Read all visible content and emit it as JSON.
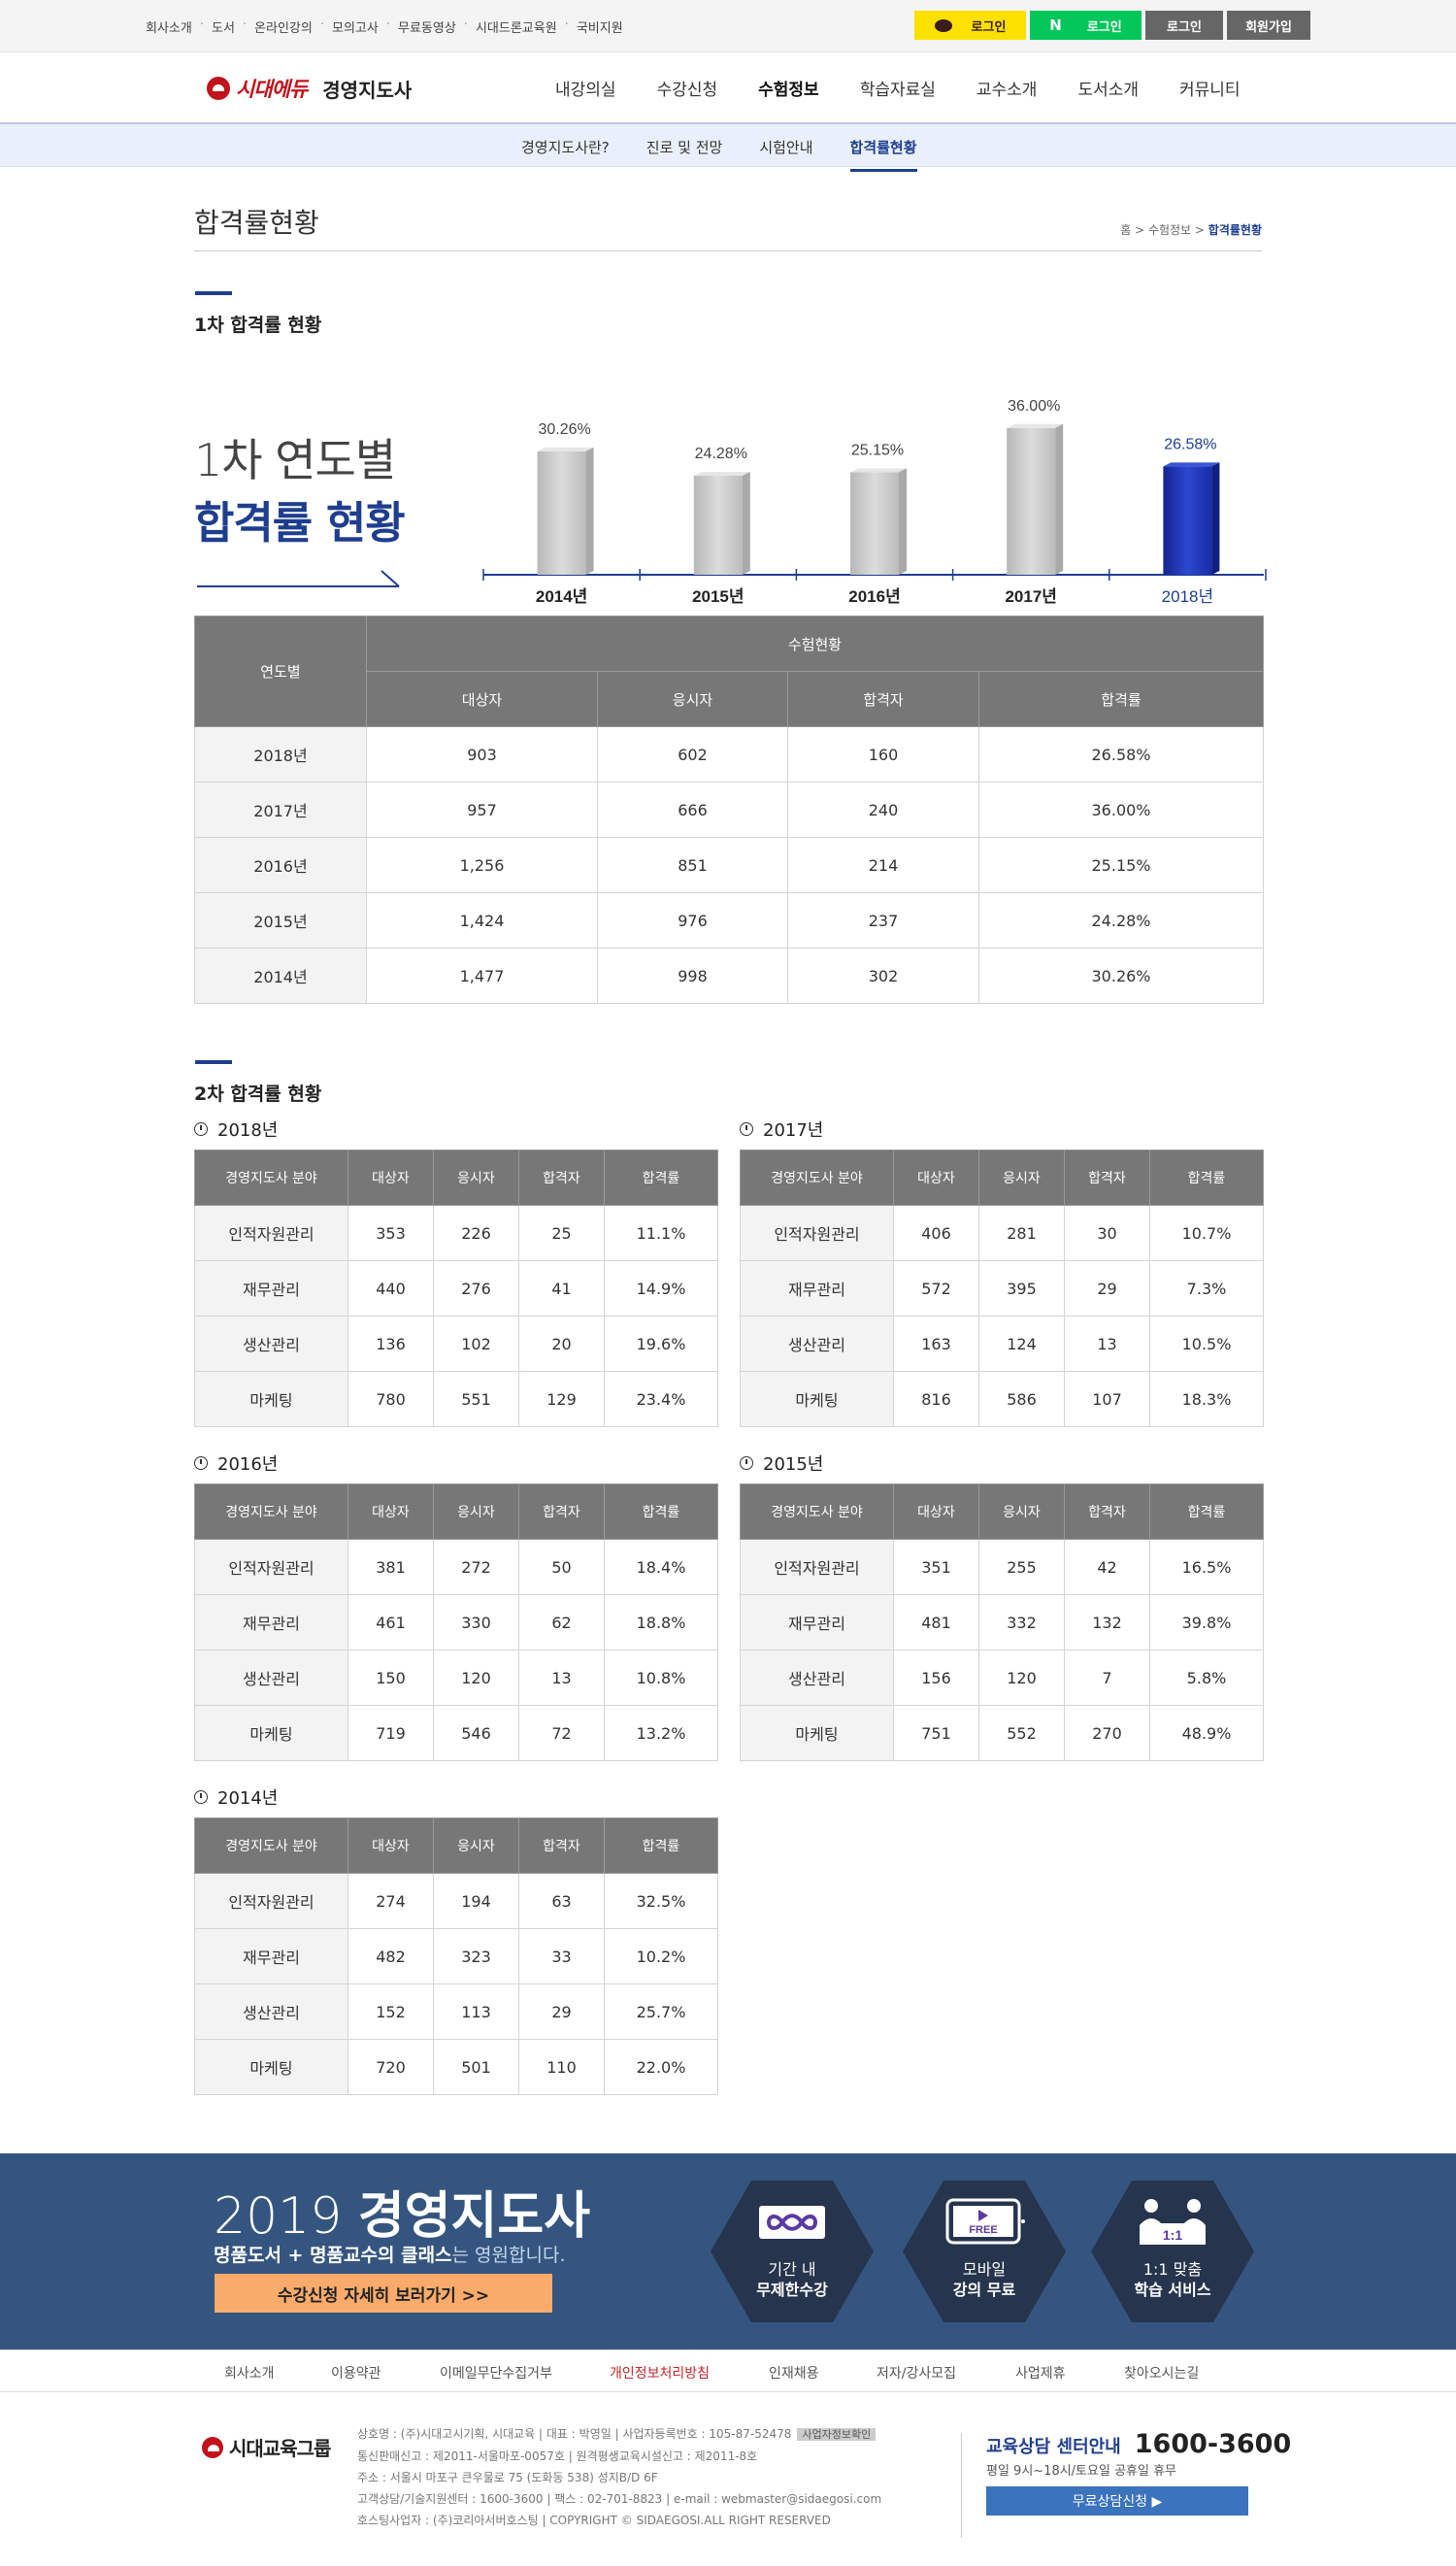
{
  "topbar": {
    "links": [
      "회사소개",
      "도서",
      "온라인강의",
      "모의고사",
      "무료동영상",
      "시대드론교육원",
      "국비지원"
    ],
    "kakao_login": "로그인",
    "naver_login": "로그인",
    "login": "로그인",
    "signup": "회원가입"
  },
  "header": {
    "logo": "시대에듀",
    "site": "경영지도사",
    "menu": [
      "내강의실",
      "수강신청",
      "수험정보",
      "학습자료실",
      "교수소개",
      "도서소개",
      "커뮤니티"
    ],
    "active_menu": "수험정보"
  },
  "subnav": {
    "items": [
      "경영지도사란?",
      "진로 및 전망",
      "시험안내",
      "합격률현황"
    ],
    "active": "합격률현황"
  },
  "page": {
    "title": "합격률현황",
    "breadcrumb": [
      "홈",
      "수험정보",
      "합격률현황"
    ]
  },
  "section1": {
    "title": "1차 합격률 현황",
    "big_line1": "1차 연도별",
    "big_line2": "합격률 현황"
  },
  "chart_data": {
    "type": "bar",
    "categories": [
      "2014년",
      "2015년",
      "2016년",
      "2017년",
      "2018년"
    ],
    "values": [
      30.26,
      24.28,
      25.15,
      36.0,
      26.58
    ],
    "labels": [
      "30.26%",
      "24.28%",
      "25.15%",
      "36.00%",
      "26.58%"
    ],
    "highlight": "2018년",
    "colors": {
      "bar": "#c8c8c8",
      "highlight": "#1c33a8"
    }
  },
  "table1": {
    "header_year": "연도별",
    "header_group": "수험현황",
    "headers": [
      "대상자",
      "응시자",
      "합격자",
      "합격률"
    ],
    "rows": [
      [
        "2018년",
        "903",
        "602",
        "160",
        "26.58%"
      ],
      [
        "2017년",
        "957",
        "666",
        "240",
        "36.00%"
      ],
      [
        "2016년",
        "1,256",
        "851",
        "214",
        "25.15%"
      ],
      [
        "2015년",
        "1,424",
        "976",
        "237",
        "24.28%"
      ],
      [
        "2014년",
        "1,477",
        "998",
        "302",
        "30.26%"
      ]
    ]
  },
  "section2": {
    "title": "2차 합격률 현황",
    "headers": [
      "경영지도사 분야",
      "대상자",
      "응시자",
      "합격자",
      "합격률"
    ],
    "years": [
      {
        "year": "2018년",
        "rows": [
          [
            "인적자원관리",
            "353",
            "226",
            "25",
            "11.1%"
          ],
          [
            "재무관리",
            "440",
            "276",
            "41",
            "14.9%"
          ],
          [
            "생산관리",
            "136",
            "102",
            "20",
            "19.6%"
          ],
          [
            "마케팅",
            "780",
            "551",
            "129",
            "23.4%"
          ]
        ]
      },
      {
        "year": "2017년",
        "rows": [
          [
            "인적자원관리",
            "406",
            "281",
            "30",
            "10.7%"
          ],
          [
            "재무관리",
            "572",
            "395",
            "29",
            "7.3%"
          ],
          [
            "생산관리",
            "163",
            "124",
            "13",
            "10.5%"
          ],
          [
            "마케팅",
            "816",
            "586",
            "107",
            "18.3%"
          ]
        ]
      },
      {
        "year": "2016년",
        "rows": [
          [
            "인적자원관리",
            "381",
            "272",
            "50",
            "18.4%"
          ],
          [
            "재무관리",
            "461",
            "330",
            "62",
            "18.8%"
          ],
          [
            "생산관리",
            "150",
            "120",
            "13",
            "10.8%"
          ],
          [
            "마케팅",
            "719",
            "546",
            "72",
            "13.2%"
          ]
        ]
      },
      {
        "year": "2015년",
        "rows": [
          [
            "인적자원관리",
            "351",
            "255",
            "42",
            "16.5%"
          ],
          [
            "재무관리",
            "481",
            "332",
            "132",
            "39.8%"
          ],
          [
            "생산관리",
            "156",
            "120",
            "7",
            "5.8%"
          ],
          [
            "마케팅",
            "751",
            "552",
            "270",
            "48.9%"
          ]
        ]
      },
      {
        "year": "2014년",
        "rows": [
          [
            "인적자원관리",
            "274",
            "194",
            "63",
            "32.5%"
          ],
          [
            "재무관리",
            "482",
            "323",
            "33",
            "10.2%"
          ],
          [
            "생산관리",
            "152",
            "113",
            "29",
            "25.7%"
          ],
          [
            "마케팅",
            "720",
            "501",
            "110",
            "22.0%"
          ]
        ]
      }
    ]
  },
  "banner": {
    "year": "2019",
    "title": "경영지도사",
    "sub_bold": "명품도서 + 명품교수의 클래스",
    "sub_rest": "는 영원합니다.",
    "button": "수강신청 자세히 보러가기 >>",
    "features": [
      {
        "icon": "infinity-icon",
        "line1": "기간 내",
        "line2": "무제한수강"
      },
      {
        "icon": "mobile-free-icon",
        "line1": "모바일",
        "line2": "강의 무료",
        "badge": "FREE"
      },
      {
        "icon": "one-to-one-icon",
        "line1": "1:1 맞춤",
        "line2": "학습 서비스",
        "badge": "1:1"
      }
    ]
  },
  "footer": {
    "nav": [
      "회사소개",
      "이용약관",
      "이메일무단수집거부",
      "개인정보처리방침",
      "인재채용",
      "저자/강사모집",
      "사업제휴",
      "찾아오시는길"
    ],
    "nav_highlight": "개인정보처리방침",
    "logo": "시대교육그룹",
    "info": [
      "상호명 : (주)시대고시기획, 시대교육 | 대표 : 박영일 | 사업자등록번호 : 105-87-52478",
      "통신판매신고 : 제2011-서울마포-0057호 | 원격평생교육시설신고 : 제2011-8호",
      "주소 : 서울시 마포구 큰우물로 75 (도화동 538) 성지B/D 6F",
      "고객상담/기술지원센터 : 1600-3600 | 팩스 : 02-701-8823 | e-mail : webmaster@sidaegosi.com",
      "호스팅사업자 : (주)코리아서버호스팅 | COPYRIGHT © SIDAEGOSI.ALL RIGHT RESERVED"
    ],
    "info_badge": "사업자정보확인",
    "call_label": "교육상담 센터안내",
    "call_number": "1600-3600",
    "hours": "평일 9시~18시/토요일 공휴일 휴무",
    "consult_button": "무료상담신청 ▶"
  }
}
